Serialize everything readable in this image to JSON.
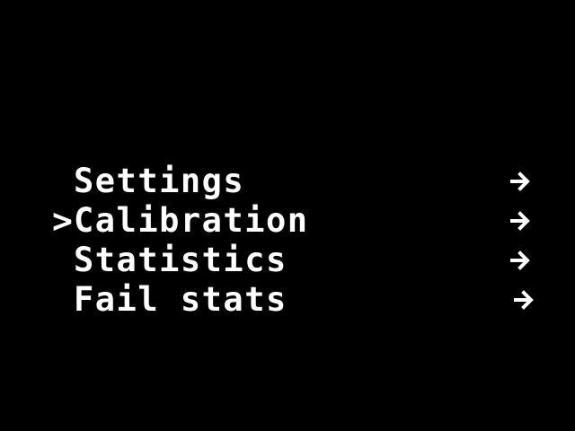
{
  "colors": {
    "background": "#000000",
    "foreground": "#ffffff"
  },
  "menu": {
    "cursor_glyph": ">",
    "selected_index": 1,
    "items": [
      {
        "label": "Settings",
        "icon": "arrow-right-icon"
      },
      {
        "label": "Calibration",
        "icon": "arrow-right-icon"
      },
      {
        "label": "Statistics",
        "icon": "arrow-right-icon"
      },
      {
        "label": "Fail stats",
        "icon": "arrow-right-icon"
      }
    ]
  }
}
